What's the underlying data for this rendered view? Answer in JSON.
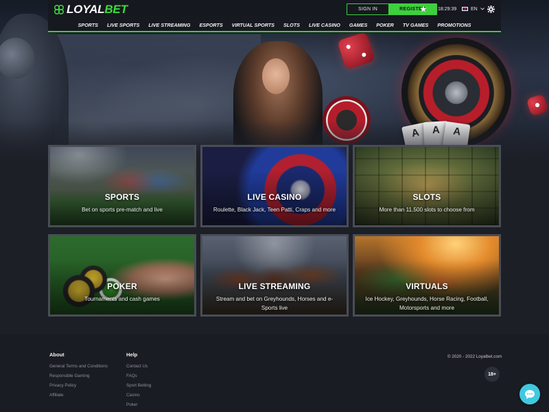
{
  "brand": {
    "name_part1": "LOYAL",
    "name_part2": "BET",
    "accent": "#3ecf3e"
  },
  "header": {
    "sign_in_label": "SIGN IN",
    "register_label": "REGISTER",
    "time": "18:29:39",
    "language": "EN",
    "icons": [
      "star-icon",
      "uk-flag-icon",
      "chevron-down-icon",
      "gear-icon"
    ]
  },
  "nav": {
    "items": [
      "SPORTS",
      "LIVE SPORTS",
      "LIVE STREAMING",
      "ESPORTS",
      "VIRTUAL SPORTS",
      "SLOTS",
      "LIVE CASINO",
      "GAMES",
      "POKER",
      "TV GAMES",
      "PROMOTIONS"
    ]
  },
  "tiles": [
    {
      "title": "SPORTS",
      "desc": "Bet on sports pre-match and live"
    },
    {
      "title": "LIVE CASINO",
      "desc": "Roulette, Black Jack, Teen Patti, Craps and more"
    },
    {
      "title": "SLOTS",
      "desc": "More than 11.500 slots to choose from"
    },
    {
      "title": "POKER",
      "desc": "Tournaments and cash games"
    },
    {
      "title": "LIVE STREAMING",
      "desc": "Stream and bet on Greyhounds, Horses and e-Sports live"
    },
    {
      "title": "VIRTUALS",
      "desc": "Ice Hockey, Greyhounds, Horse Racing, Football, Motorsports and more"
    }
  ],
  "footer": {
    "about": {
      "heading": "About",
      "links": [
        "General Terms and Conditions",
        "Responsible Gaming",
        "Privacy Policy",
        "Affiliate"
      ]
    },
    "help": {
      "heading": "Help",
      "links": [
        "Contact Us",
        "FAQs",
        "Sport Betting",
        "Casino",
        "Poker"
      ]
    },
    "copyright": "© 2020 - 2022 Loyalbet.com",
    "age_badge": "18+"
  },
  "colors": {
    "page_bg": "#1d1f27",
    "footer_bg": "#1a1c23",
    "accent_green": "#3ecf3e",
    "chat_button": "#3fc9e0"
  }
}
